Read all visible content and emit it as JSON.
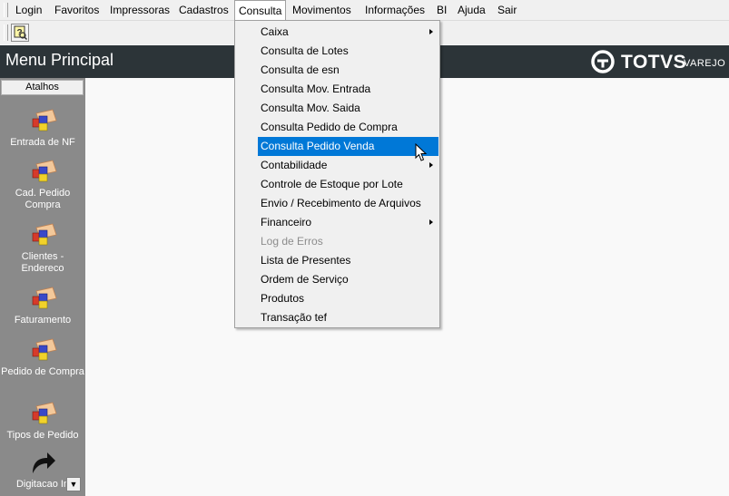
{
  "menubar": {
    "items": [
      {
        "label": "Login"
      },
      {
        "label": "Favoritos"
      },
      {
        "label": "Impressoras"
      },
      {
        "label": "Cadastros"
      },
      {
        "label": "Consulta"
      },
      {
        "label": "Movimentos"
      },
      {
        "label": "Informações"
      },
      {
        "label": "BI"
      },
      {
        "label": "Ajuda"
      },
      {
        "label": "Sair"
      }
    ],
    "open_item": "Consulta"
  },
  "toolbar": {
    "button_icon": "help-search-icon"
  },
  "header": {
    "title": "Menu Principal",
    "logo_text": "TOTVS",
    "logo_subtext": "VAREJO"
  },
  "sidebar": {
    "heading": "Atalhos",
    "shortcuts": [
      {
        "label": "Entrada de NF",
        "icon": "blocks-icon"
      },
      {
        "label": "Cad. Pedido Compra",
        "icon": "blocks-icon"
      },
      {
        "label": "Clientes - Endereco",
        "icon": "blocks-icon"
      },
      {
        "label": "Faturamento",
        "icon": "blocks-icon"
      },
      {
        "label": "Pedido de Compra",
        "icon": "blocks-icon"
      },
      {
        "label": "Tipos de Pedido",
        "icon": "blocks-icon"
      },
      {
        "label": "Digitacao In",
        "icon": "curved-arrow-icon"
      }
    ]
  },
  "dropdown": {
    "items": [
      {
        "label": "Caixa",
        "submenu": true
      },
      {
        "label": "Consulta de Lotes"
      },
      {
        "label": "Consulta de esn"
      },
      {
        "label": "Consulta Mov. Entrada"
      },
      {
        "label": "Consulta Mov. Saida"
      },
      {
        "label": "Consulta Pedido de Compra"
      },
      {
        "label": "Consulta Pedido Venda",
        "highlighted": true
      },
      {
        "label": "Contabilidade",
        "submenu": true
      },
      {
        "label": "Controle de Estoque por Lote"
      },
      {
        "label": "Envio / Recebimento de Arquivos"
      },
      {
        "label": "Financeiro",
        "submenu": true
      },
      {
        "label": "Log de Erros",
        "disabled": true
      },
      {
        "label": "Lista de Presentes"
      },
      {
        "label": "Ordem de Serviço"
      },
      {
        "label": "Produtos"
      },
      {
        "label": "Transação tef"
      }
    ]
  },
  "colors": {
    "highlight": "#0078d7",
    "header_bg": "#2c3438",
    "sidebar_bg": "#8a8a8a"
  }
}
